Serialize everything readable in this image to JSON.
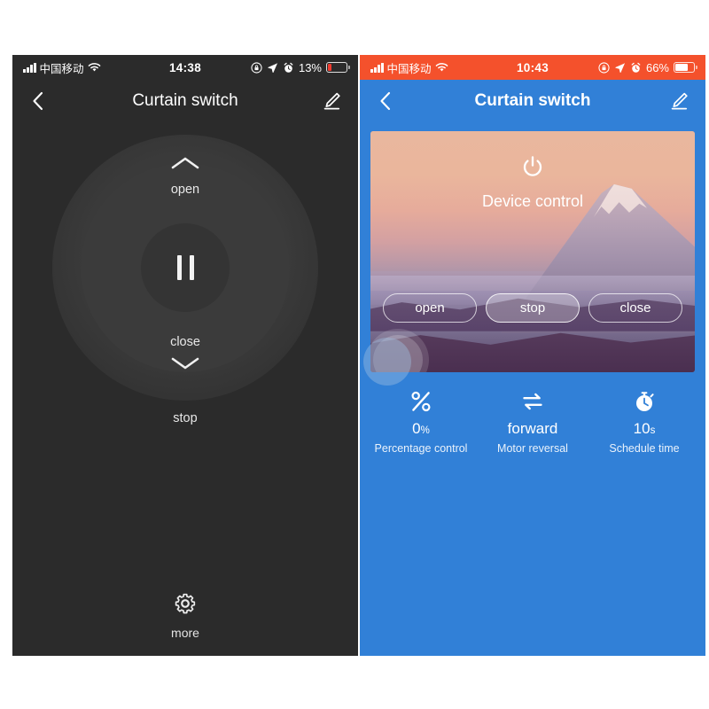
{
  "left_phone": {
    "status_bar": {
      "carrier": "中国移动",
      "time": "14:38",
      "battery_percent": "13%",
      "icons": [
        "signal-bars-icon",
        "wifi-icon",
        "rotation-lock-icon",
        "location-arrow-icon",
        "alarm-clock-icon",
        "battery-icon"
      ]
    },
    "nav": {
      "back_icon": "chevron-left-icon",
      "title": "Curtain switch",
      "edit_icon": "pencil-edit-icon"
    },
    "dial": {
      "open_label": "open",
      "open_icon": "chevron-up-icon",
      "center_icon": "pause-icon",
      "close_label": "close",
      "close_icon": "chevron-down-icon",
      "stop_label": "stop"
    },
    "more": {
      "icon": "gear-icon",
      "label": "more"
    },
    "colors": {
      "background": "#2b2b2b",
      "ring_outer": "#3a3a3a",
      "ring_inner": "#343434"
    }
  },
  "right_phone": {
    "status_bar": {
      "carrier": "中国移动",
      "time": "10:43",
      "battery_percent": "66%",
      "icons": [
        "signal-bars-icon",
        "wifi-icon",
        "rotation-lock-icon",
        "location-arrow-icon",
        "alarm-clock-icon",
        "battery-icon"
      ]
    },
    "nav": {
      "back_icon": "chevron-left-icon",
      "title": "Curtain switch",
      "edit_icon": "pencil-edit-icon"
    },
    "card": {
      "power_icon": "power-icon",
      "title": "Device control",
      "buttons": [
        {
          "label": "open",
          "active": false
        },
        {
          "label": "stop",
          "active": true
        },
        {
          "label": "close",
          "active": false
        }
      ]
    },
    "features": [
      {
        "icon": "percent-icon",
        "value": "0",
        "unit": "%",
        "name": "Percentage control"
      },
      {
        "icon": "swap-arrows-icon",
        "value": "forward",
        "unit": "",
        "name": "Motor reversal"
      },
      {
        "icon": "stopwatch-icon",
        "value": "10",
        "unit": "s",
        "name": "Schedule time"
      }
    ],
    "colors": {
      "background": "#3180d7",
      "status_bar": "#f4512c"
    }
  }
}
